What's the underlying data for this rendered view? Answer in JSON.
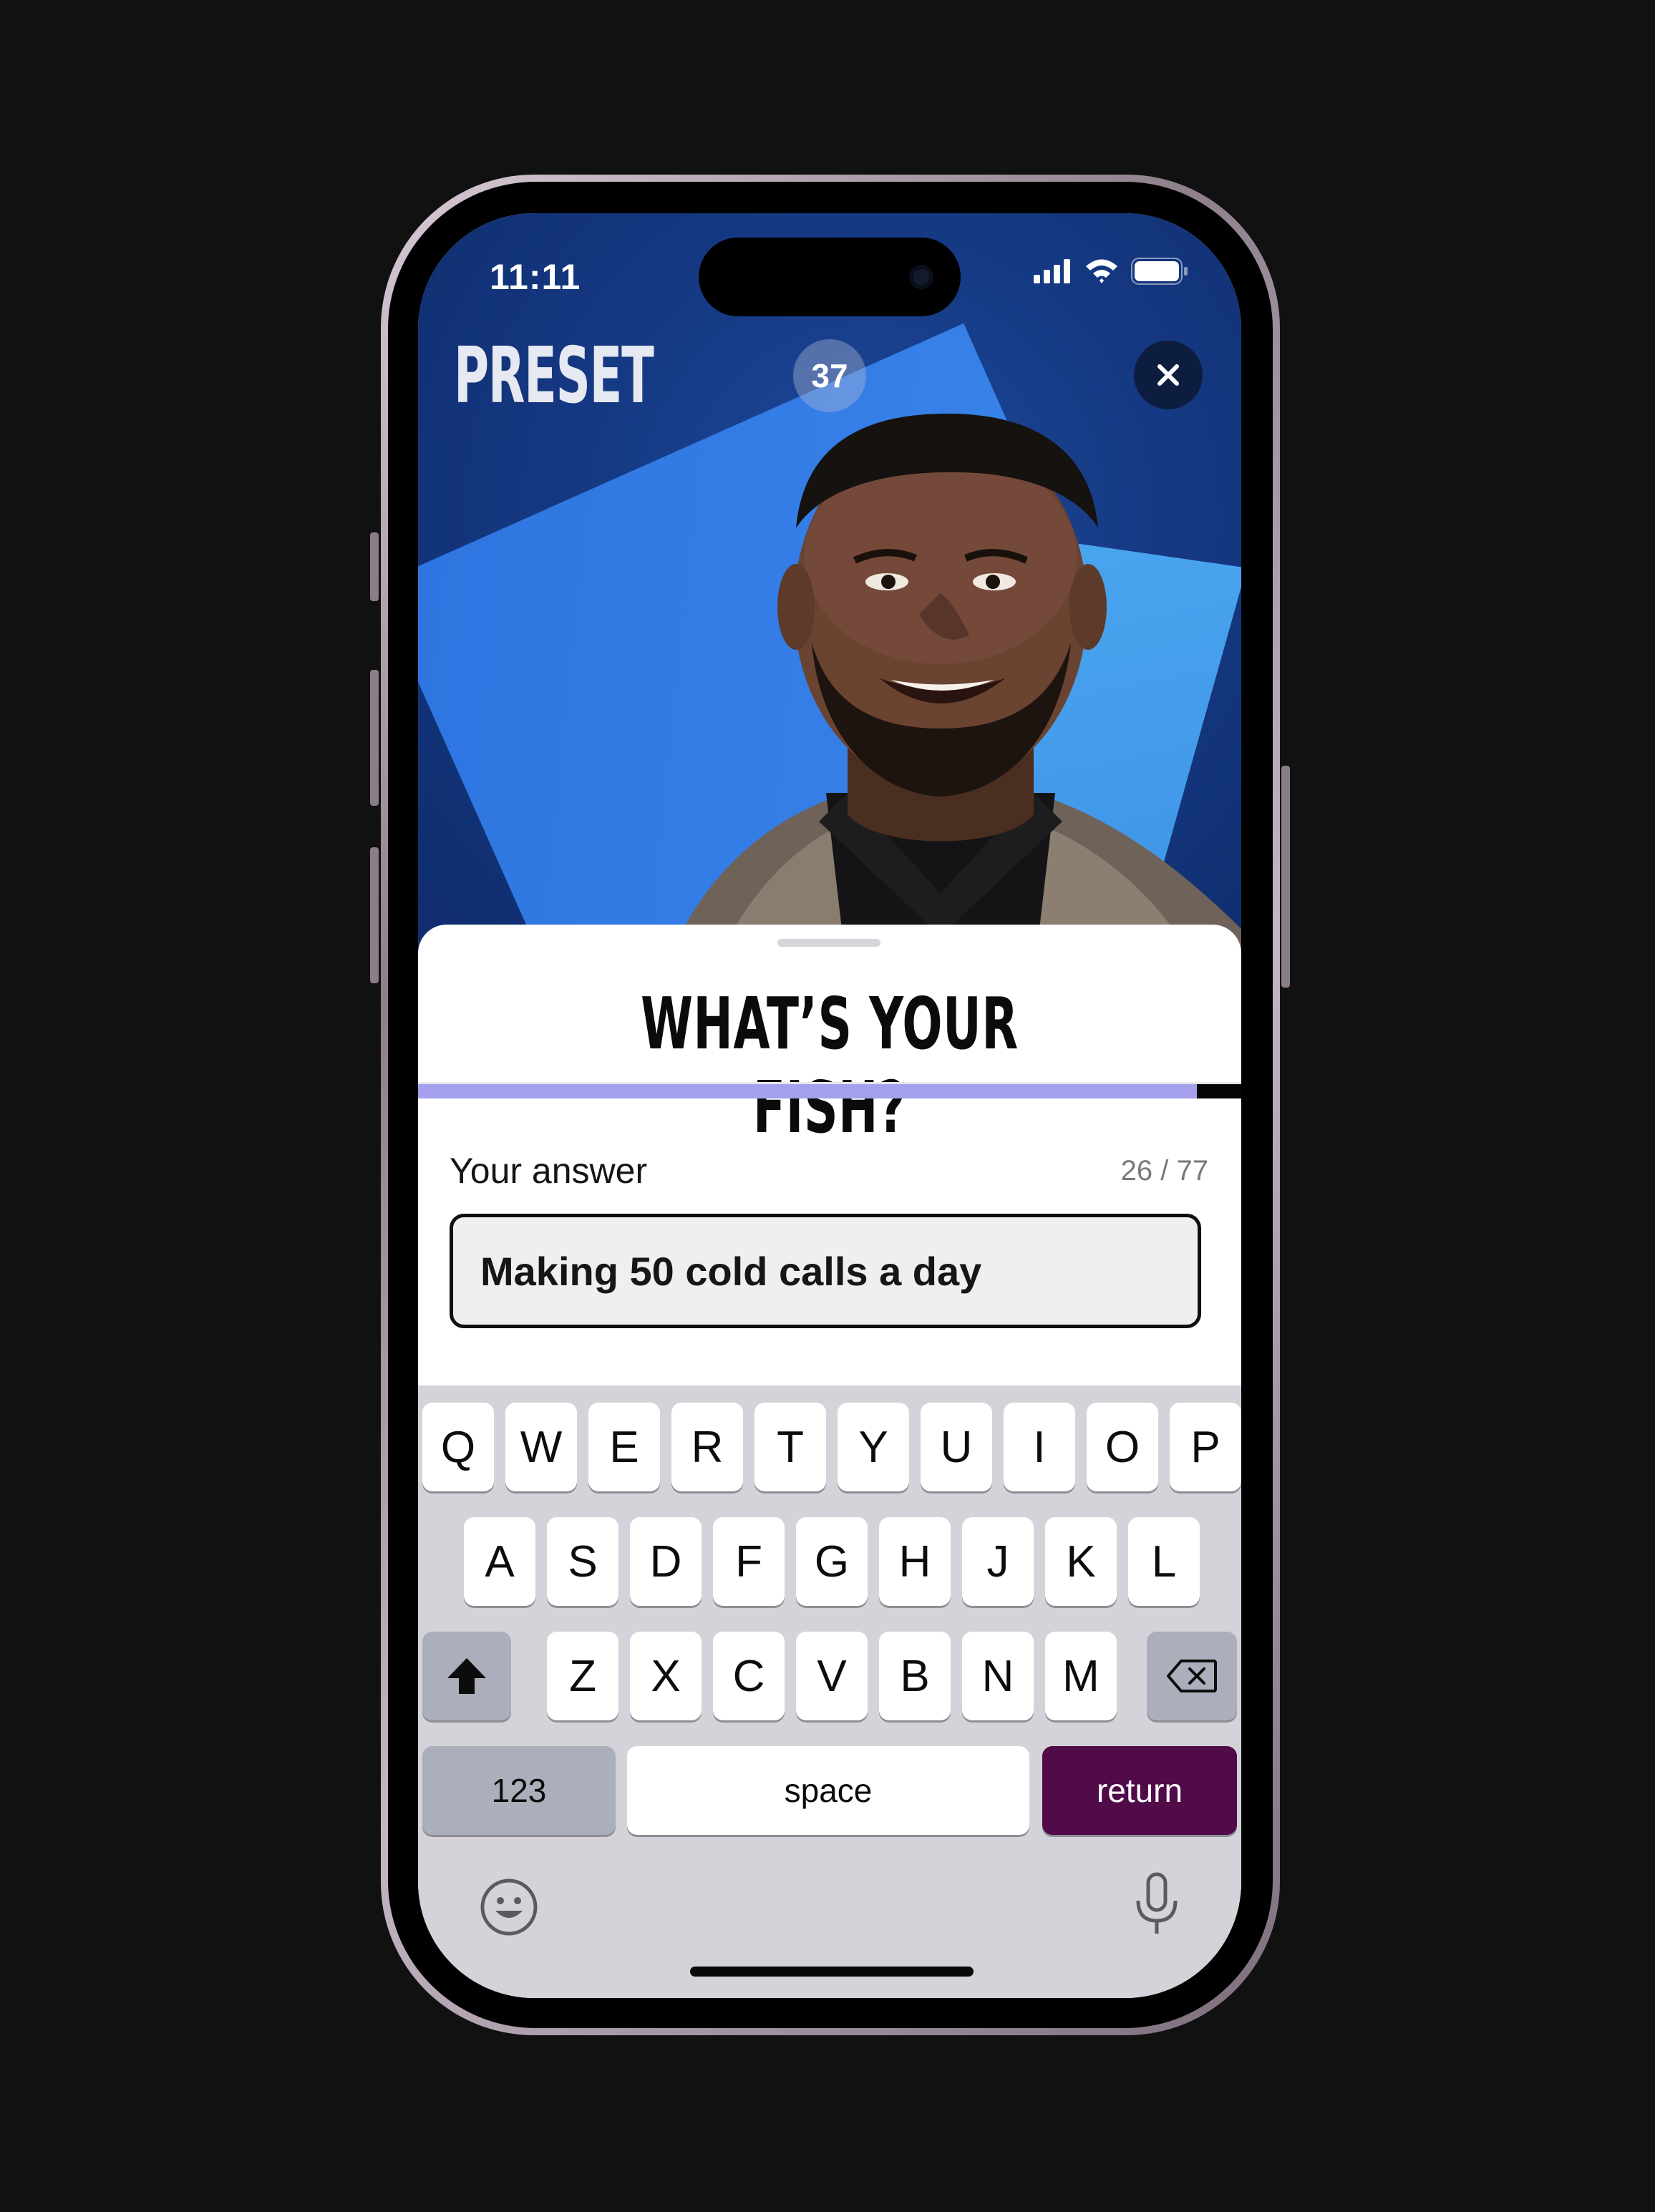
{
  "status_bar": {
    "time": "11:11"
  },
  "header": {
    "brand": "PRESET",
    "counter": "37",
    "close_icon": "close-icon"
  },
  "prompt": {
    "question": "WHAT’S YOUR FISH?",
    "progress": 0.946
  },
  "answer": {
    "label": "Your answer",
    "count": "26 / 77",
    "value": "Making 50 cold calls a day"
  },
  "keyboard": {
    "row1": [
      "Q",
      "W",
      "E",
      "R",
      "T",
      "Y",
      "U",
      "I",
      "O",
      "P"
    ],
    "row2": [
      "A",
      "S",
      "D",
      "F",
      "G",
      "H",
      "J",
      "K",
      "L"
    ],
    "row3": [
      "Z",
      "X",
      "C",
      "V",
      "B",
      "N",
      "M"
    ],
    "numbers_label": "123",
    "space_label": "space",
    "return_label": "return",
    "shift_icon": "shift-icon",
    "delete_icon": "delete-icon",
    "emoji_icon": "emoji-icon",
    "mic_icon": "microphone-icon"
  },
  "colors": {
    "background": "#111111",
    "hero_blue": "#153983",
    "progress": "#a4a0ec",
    "return_key": "#500b48"
  }
}
